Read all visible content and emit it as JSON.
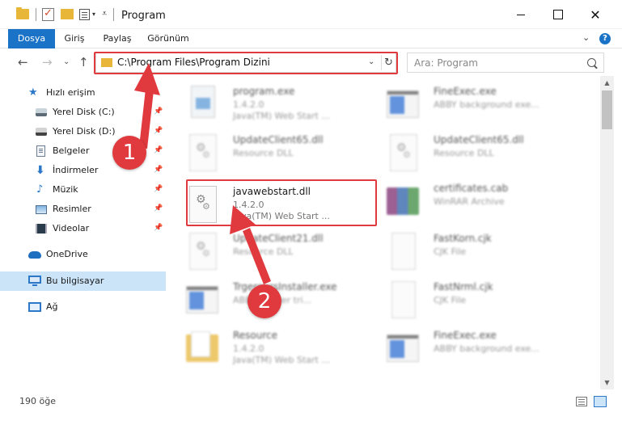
{
  "window": {
    "title": "Program",
    "controls": {
      "minimize": "",
      "maximize": "",
      "close": "✕"
    }
  },
  "ribbon": {
    "tabs": [
      {
        "label": "Dosya",
        "active": true
      },
      {
        "label": "Giriş",
        "active": false
      },
      {
        "label": "Paylaş",
        "active": false
      },
      {
        "label": "Görünüm",
        "active": false
      }
    ],
    "help": "?"
  },
  "nav": {
    "back": "←",
    "forward": "→",
    "recent": "⌄",
    "up": "↑",
    "address": "C:\\Program Files\\Program Dizini",
    "refresh": "↻",
    "search_placeholder": "Ara: Program"
  },
  "sidebar": {
    "items": [
      {
        "label": "Hızlı erişim",
        "icon": "star-icon",
        "pinned": false
      },
      {
        "label": "Yerel Disk (C:)",
        "icon": "disk-c-icon",
        "pinned": true
      },
      {
        "label": "Yerel Disk (D:)",
        "icon": "disk-d-icon",
        "pinned": true
      },
      {
        "label": "Belgeler",
        "icon": "documents-icon",
        "pinned": true
      },
      {
        "label": "İndirmeler",
        "icon": "downloads-icon",
        "pinned": true
      },
      {
        "label": "Müzik",
        "icon": "music-icon",
        "pinned": true
      },
      {
        "label": "Resimler",
        "icon": "pictures-icon",
        "pinned": true
      },
      {
        "label": "Videolar",
        "icon": "videos-icon",
        "pinned": true
      },
      {
        "label": "OneDrive",
        "icon": "onedrive-icon",
        "pinned": false
      },
      {
        "label": "Bu bilgisayar",
        "icon": "this-pc-icon",
        "pinned": false,
        "selected": true
      },
      {
        "label": "Ağ",
        "icon": "network-icon",
        "pinned": false
      }
    ]
  },
  "files": [
    {
      "name": "program.exe",
      "line1": "1.4.2.0",
      "line2": "Java(TM) Web Start ...",
      "icon": "exe-icon"
    },
    {
      "name": "FineExec.exe",
      "line1": "ABBY background exe...",
      "line2": "",
      "icon": "app-window-icon"
    },
    {
      "name": "UpdateClient65.dll",
      "line1": "Resource DLL",
      "line2": "",
      "icon": "dll-gear-icon"
    },
    {
      "name": "UpdateClient65.dll",
      "line1": "Resource DLL",
      "line2": "",
      "icon": "dll-gear-icon"
    },
    {
      "name": "javawebstart.dll",
      "line1": "1.4.2.0",
      "line2": "Java(TM) Web Start ...",
      "icon": "dll-gear-icon"
    },
    {
      "name": "certificates.cab",
      "line1": "WinRAR Archive",
      "line2": "",
      "icon": "winrar-archive-icon"
    },
    {
      "name": "UpdateClient21.dll",
      "line1": "Resource DLL",
      "line2": "",
      "icon": "dll-gear-icon"
    },
    {
      "name": "FastKorn.cjk",
      "line1": "CJK File",
      "line2": "",
      "icon": "blank-file-icon"
    },
    {
      "name": "TrgeroursInstaller.exe",
      "line1": "ABBY Reader tri...",
      "line2": "",
      "icon": "app-window-icon"
    },
    {
      "name": "FastNrml.cjk",
      "line1": "CJK File",
      "line2": "",
      "icon": "blank-file-icon"
    },
    {
      "name": "Resource",
      "line1": "1.4.2.0",
      "line2": "Java(TM) Web Start ...",
      "icon": "folder-icon"
    },
    {
      "name": "FineExec.exe",
      "line1": "ABBY background exe...",
      "line2": "",
      "icon": "app-window-icon"
    }
  ],
  "status": {
    "count": "190 öğe"
  },
  "annotations": {
    "badge1": "1",
    "badge2": "2"
  },
  "colors": {
    "accent": "#1a73c7",
    "highlight": "#e0393e",
    "folder": "#e8b73a",
    "selected": "#cce4f7"
  }
}
